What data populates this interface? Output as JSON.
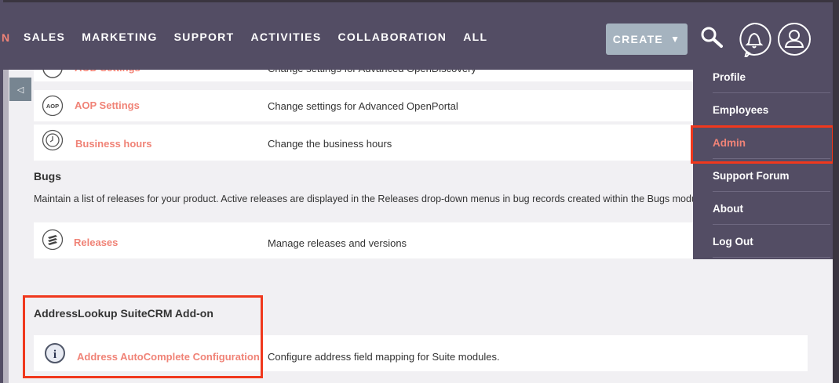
{
  "nav": {
    "partial_item": "N",
    "items": [
      "SALES",
      "MARKETING",
      "SUPPORT",
      "ACTIVITIES",
      "COLLABORATION",
      "ALL"
    ],
    "create_label": "CREATE",
    "create_caret": "▼"
  },
  "sidebar": {
    "toggle_glyph": "◁"
  },
  "rows": [
    {
      "label": "AOD Settings",
      "desc": "Change settings for Advanced OpenDiscovery",
      "icon": "aod-icon"
    },
    {
      "label": "AOP Settings",
      "desc": "Change settings for Advanced OpenPortal",
      "icon": "aop-icon",
      "icon_text": "AOP"
    },
    {
      "label": "Business hours",
      "desc": "Change the business hours",
      "icon": "clock-icon"
    },
    {
      "label": "Releases",
      "desc": "Manage releases and versions",
      "icon": "releases-icon"
    },
    {
      "label": "Address AutoComplete Configuration",
      "desc": "Configure address field mapping for Suite modules.",
      "icon": "info-icon",
      "icon_text": "i"
    }
  ],
  "sections": {
    "bugs_title": "Bugs",
    "bugs_desc": "Maintain a list of releases for your product. Active releases are displayed in the Releases drop-down menus in bug records created within the Bugs module.",
    "addon_title": "AddressLookup SuiteCRM Add-on"
  },
  "user_menu": {
    "items": [
      "Profile",
      "Employees",
      "Admin",
      "Support Forum",
      "About",
      "Log Out"
    ],
    "active": "Admin"
  },
  "colors": {
    "nav_bg": "#534d64",
    "accent": "#f08377",
    "highlight": "#f0381d",
    "create_bg": "#a5b3bf"
  }
}
